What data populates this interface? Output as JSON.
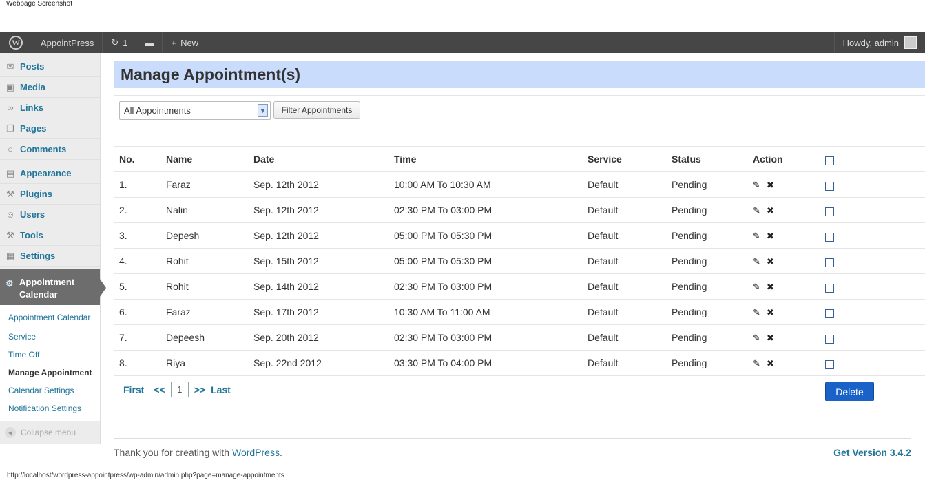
{
  "caption": "Webpage Screenshot",
  "adminbar": {
    "site_name": "AppointPress",
    "updates_count": "1",
    "new_label": "New",
    "howdy": "Howdy, admin"
  },
  "sidebar": {
    "items": [
      {
        "label": "Posts",
        "icon": "pin-icon"
      },
      {
        "label": "Media",
        "icon": "media-icon"
      },
      {
        "label": "Links",
        "icon": "link-icon"
      },
      {
        "label": "Pages",
        "icon": "pages-icon"
      },
      {
        "label": "Comments",
        "icon": "comment-icon"
      },
      {
        "label": "Appearance",
        "icon": "appearance-icon"
      },
      {
        "label": "Plugins",
        "icon": "plugin-icon"
      },
      {
        "label": "Users",
        "icon": "users-icon"
      },
      {
        "label": "Tools",
        "icon": "tools-icon"
      },
      {
        "label": "Settings",
        "icon": "settings-icon"
      }
    ],
    "current": "Appointment Calendar",
    "submenu": [
      "Appointment Calendar",
      "Service",
      "Time Off",
      "Manage Appointment",
      "Calendar Settings",
      "Notification Settings"
    ],
    "collapse": "Collapse menu"
  },
  "page": {
    "title": "Manage Appointment(s)",
    "filter_selected": "All Appointments",
    "filter_button": "Filter Appointments"
  },
  "table": {
    "headers": [
      "No.",
      "Name",
      "Date",
      "Time",
      "Service",
      "Status",
      "Action"
    ],
    "rows": [
      {
        "no": "1.",
        "name": "Faraz",
        "date": "Sep. 12th 2012",
        "time": "10:00 AM To 10:30 AM",
        "service": "Default",
        "status": "Pending"
      },
      {
        "no": "2.",
        "name": "Nalin",
        "date": "Sep. 12th 2012",
        "time": "02:30 PM To 03:00 PM",
        "service": "Default",
        "status": "Pending"
      },
      {
        "no": "3.",
        "name": "Depesh",
        "date": "Sep. 12th 2012",
        "time": "05:00 PM To 05:30 PM",
        "service": "Default",
        "status": "Pending"
      },
      {
        "no": "4.",
        "name": "Rohit",
        "date": "Sep. 15th 2012",
        "time": "05:00 PM To 05:30 PM",
        "service": "Default",
        "status": "Pending"
      },
      {
        "no": "5.",
        "name": "Rohit",
        "date": "Sep. 14th 2012",
        "time": "02:30 PM To 03:00 PM",
        "service": "Default",
        "status": "Pending"
      },
      {
        "no": "6.",
        "name": "Faraz",
        "date": "Sep. 17th 2012",
        "time": "10:30 AM To 11:00 AM",
        "service": "Default",
        "status": "Pending"
      },
      {
        "no": "7.",
        "name": "Depeesh",
        "date": "Sep. 20th 2012",
        "time": "02:30 PM To 03:00 PM",
        "service": "Default",
        "status": "Pending"
      },
      {
        "no": "8.",
        "name": "Riya",
        "date": "Sep. 22nd 2012",
        "time": "03:30 PM To 04:00 PM",
        "service": "Default",
        "status": "Pending"
      }
    ]
  },
  "pager": {
    "first": "First",
    "prev": "<<",
    "current": "1",
    "next": ">>",
    "last": "Last"
  },
  "delete_label": "Delete",
  "footer": {
    "thanks": "Thank you for creating with ",
    "link": "WordPress",
    "period": ".",
    "version": "Get Version 3.4.2"
  },
  "status_url": "http://localhost/wordpress-appointpress/wp-admin/admin.php?page=manage-appointments"
}
